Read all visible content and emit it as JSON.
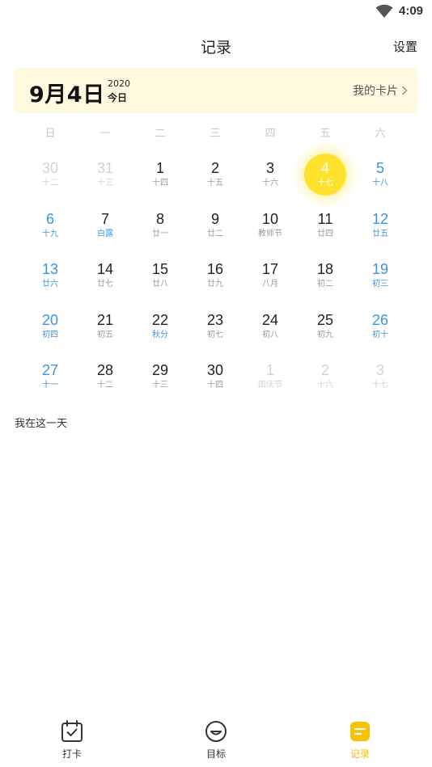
{
  "status": {
    "time": "4:09"
  },
  "header": {
    "title": "记录",
    "settings_label": "设置"
  },
  "date_card": {
    "big_date": "9月4日",
    "year": "2020",
    "today_label": "今日",
    "my_card_label": "我的卡片"
  },
  "weekdays": [
    "日",
    "一",
    "二",
    "三",
    "四",
    "五",
    "六"
  ],
  "calendar": [
    {
      "num": "30",
      "sub": "十二",
      "type": "muted"
    },
    {
      "num": "31",
      "sub": "十三",
      "type": "muted"
    },
    {
      "num": "1",
      "sub": "十四",
      "type": "normal"
    },
    {
      "num": "2",
      "sub": "十五",
      "type": "normal"
    },
    {
      "num": "3",
      "sub": "十六",
      "type": "normal"
    },
    {
      "num": "4",
      "sub": "十七",
      "type": "selected"
    },
    {
      "num": "5",
      "sub": "十八",
      "type": "weekend"
    },
    {
      "num": "6",
      "sub": "十九",
      "type": "weekend"
    },
    {
      "num": "7",
      "sub": "白露",
      "type": "accent"
    },
    {
      "num": "8",
      "sub": "廿一",
      "type": "normal"
    },
    {
      "num": "9",
      "sub": "廿二",
      "type": "normal"
    },
    {
      "num": "10",
      "sub": "教师节",
      "type": "normal"
    },
    {
      "num": "11",
      "sub": "廿四",
      "type": "normal"
    },
    {
      "num": "12",
      "sub": "廿五",
      "type": "weekend"
    },
    {
      "num": "13",
      "sub": "廿六",
      "type": "weekend"
    },
    {
      "num": "14",
      "sub": "廿七",
      "type": "normal"
    },
    {
      "num": "15",
      "sub": "廿八",
      "type": "normal"
    },
    {
      "num": "16",
      "sub": "廿九",
      "type": "normal"
    },
    {
      "num": "17",
      "sub": "八月",
      "type": "normal"
    },
    {
      "num": "18",
      "sub": "初二",
      "type": "normal"
    },
    {
      "num": "19",
      "sub": "初三",
      "type": "weekend"
    },
    {
      "num": "20",
      "sub": "初四",
      "type": "weekend"
    },
    {
      "num": "21",
      "sub": "初五",
      "type": "normal"
    },
    {
      "num": "22",
      "sub": "秋分",
      "type": "accent"
    },
    {
      "num": "23",
      "sub": "初七",
      "type": "normal"
    },
    {
      "num": "24",
      "sub": "初八",
      "type": "normal"
    },
    {
      "num": "25",
      "sub": "初九",
      "type": "normal"
    },
    {
      "num": "26",
      "sub": "初十",
      "type": "weekend"
    },
    {
      "num": "27",
      "sub": "十一",
      "type": "weekend"
    },
    {
      "num": "28",
      "sub": "十二",
      "type": "normal"
    },
    {
      "num": "29",
      "sub": "十三",
      "type": "normal"
    },
    {
      "num": "30",
      "sub": "十四",
      "type": "normal"
    },
    {
      "num": "1",
      "sub": "国庆节",
      "type": "muted"
    },
    {
      "num": "2",
      "sub": "十六",
      "type": "muted"
    },
    {
      "num": "3",
      "sub": "十七",
      "type": "muted"
    }
  ],
  "section_label": "我在这一天",
  "tabs": [
    {
      "label": "打卡",
      "icon": "calendar-check-icon",
      "active": false
    },
    {
      "label": "目标",
      "icon": "smile-icon",
      "active": false
    },
    {
      "label": "记录",
      "icon": "note-icon",
      "active": true
    }
  ],
  "colors": {
    "accent_yellow": "#ffe22e",
    "weekend_blue": "#3b94e0",
    "card_bg": "#fff9e0",
    "tab_active": "#f5b800"
  }
}
